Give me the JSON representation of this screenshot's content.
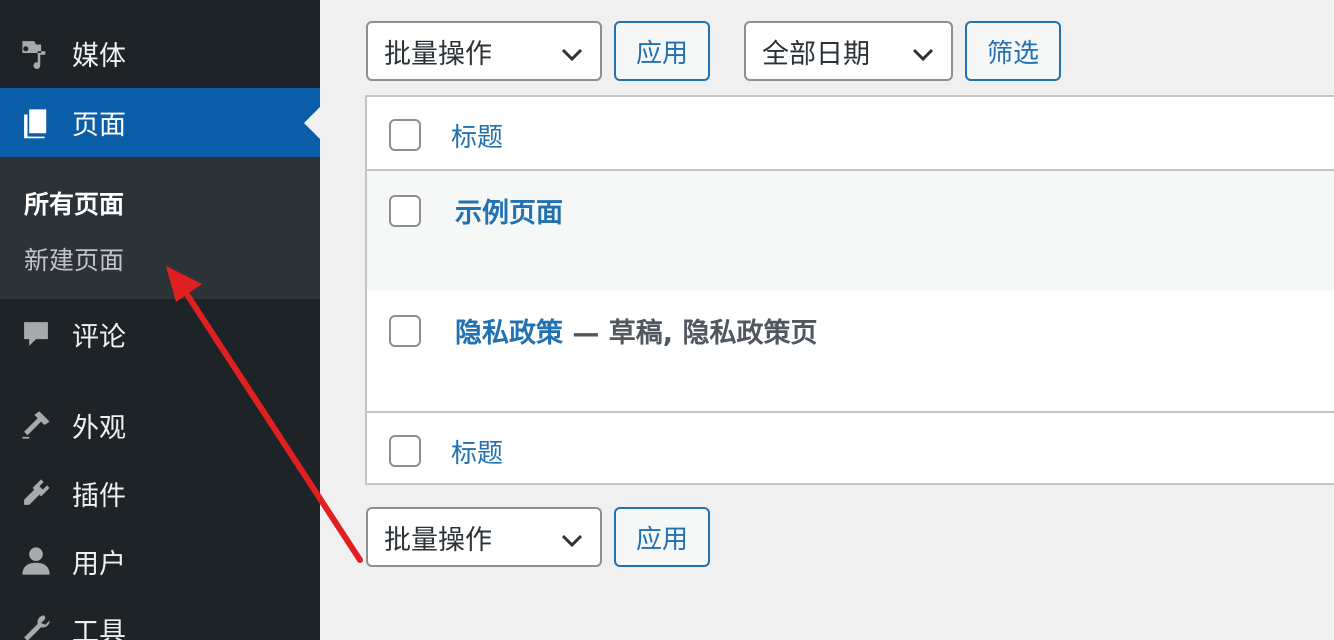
{
  "sidebar": {
    "items": [
      {
        "key": "media",
        "label": "媒体",
        "icon": "media-icon"
      },
      {
        "key": "pages",
        "label": "页面",
        "icon": "pages-icon",
        "current": true
      },
      {
        "key": "comments",
        "label": "评论",
        "icon": "comments-icon"
      },
      {
        "key": "appearance",
        "label": "外观",
        "icon": "appearance-icon"
      },
      {
        "key": "plugins",
        "label": "插件",
        "icon": "plugins-icon"
      },
      {
        "key": "users",
        "label": "用户",
        "icon": "users-icon"
      },
      {
        "key": "tools",
        "label": "工具",
        "icon": "tools-icon"
      }
    ],
    "submenu": {
      "all_pages": "所有页面",
      "add_new": "新建页面"
    }
  },
  "top_controls": {
    "bulk_action": "批量操作",
    "apply": "应用",
    "date_filter": "全部日期",
    "filter": "筛选"
  },
  "table": {
    "column_title": "标题",
    "rows": [
      {
        "title": "示例页面",
        "state": ""
      },
      {
        "title": "隐私政策",
        "state": " — 草稿, 隐私政策页"
      }
    ]
  },
  "bottom_controls": {
    "bulk_action": "批量操作",
    "apply": "应用"
  },
  "colors": {
    "sidebar_bg": "#1d2327",
    "current_item_bg": "#0a5ea8",
    "link_blue": "#2271b1",
    "arrow_red": "#e02020"
  }
}
